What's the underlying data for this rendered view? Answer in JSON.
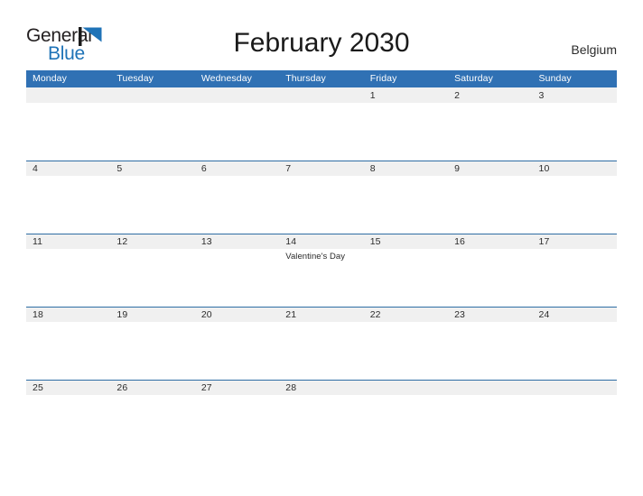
{
  "brand": {
    "logo_word_1": "General",
    "logo_word_2": "Blue",
    "flag_icon": "blue-triangle-flag-icon",
    "accent_color": "#1f73b7"
  },
  "header": {
    "title": "February 2030",
    "country": "Belgium"
  },
  "calendar": {
    "header_color": "#3071b4",
    "band_color": "#f0f0f0",
    "row_line_color": "#2e6da4",
    "weekdays": [
      "Monday",
      "Tuesday",
      "Wednesday",
      "Thursday",
      "Friday",
      "Saturday",
      "Sunday"
    ],
    "weeks": [
      [
        {
          "day": "",
          "event": ""
        },
        {
          "day": "",
          "event": ""
        },
        {
          "day": "",
          "event": ""
        },
        {
          "day": "",
          "event": ""
        },
        {
          "day": "1",
          "event": ""
        },
        {
          "day": "2",
          "event": ""
        },
        {
          "day": "3",
          "event": ""
        }
      ],
      [
        {
          "day": "4",
          "event": ""
        },
        {
          "day": "5",
          "event": ""
        },
        {
          "day": "6",
          "event": ""
        },
        {
          "day": "7",
          "event": ""
        },
        {
          "day": "8",
          "event": ""
        },
        {
          "day": "9",
          "event": ""
        },
        {
          "day": "10",
          "event": ""
        }
      ],
      [
        {
          "day": "11",
          "event": ""
        },
        {
          "day": "12",
          "event": ""
        },
        {
          "day": "13",
          "event": ""
        },
        {
          "day": "14",
          "event": "Valentine's Day"
        },
        {
          "day": "15",
          "event": ""
        },
        {
          "day": "16",
          "event": ""
        },
        {
          "day": "17",
          "event": ""
        }
      ],
      [
        {
          "day": "18",
          "event": ""
        },
        {
          "day": "19",
          "event": ""
        },
        {
          "day": "20",
          "event": ""
        },
        {
          "day": "21",
          "event": ""
        },
        {
          "day": "22",
          "event": ""
        },
        {
          "day": "23",
          "event": ""
        },
        {
          "day": "24",
          "event": ""
        }
      ],
      [
        {
          "day": "25",
          "event": ""
        },
        {
          "day": "26",
          "event": ""
        },
        {
          "day": "27",
          "event": ""
        },
        {
          "day": "28",
          "event": ""
        },
        {
          "day": "",
          "event": ""
        },
        {
          "day": "",
          "event": ""
        },
        {
          "day": "",
          "event": ""
        }
      ]
    ]
  }
}
